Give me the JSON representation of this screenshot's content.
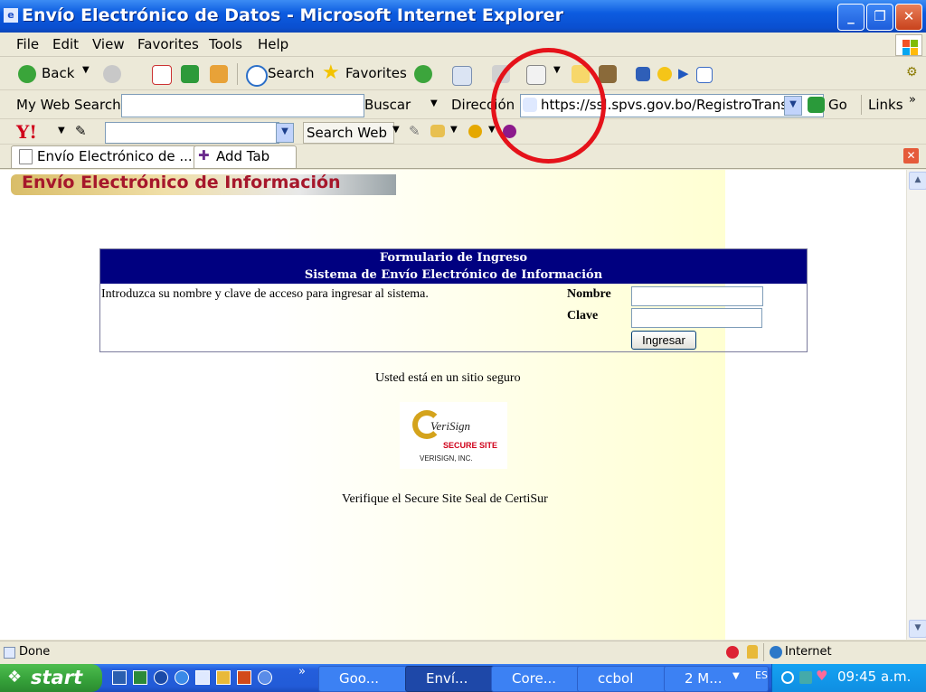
{
  "window": {
    "title": "Envío Electrónico de Datos - Microsoft Internet Explorer"
  },
  "menu": [
    "File",
    "Edit",
    "View",
    "Favorites",
    "Tools",
    "Help"
  ],
  "toolbar": {
    "back": "Back",
    "search": "Search",
    "favorites": "Favorites"
  },
  "searchbar": {
    "label": "My Web Search",
    "buscar": "Buscar",
    "address_label": "Dirección",
    "url": "https://ssl.spvs.gov.bo/RegistroTransf",
    "go": "Go",
    "links": "Links"
  },
  "yahoo": {
    "logo": "Y!",
    "search_web": "Search Web"
  },
  "tabs": {
    "active": "Envío Electrónico de ...",
    "add": "Add Tab"
  },
  "page": {
    "header": "Envío Electrónico de Información",
    "form": {
      "title1": "Formulario de Ingreso",
      "title2": "Sistema de Envío Electrónico de Información",
      "instructions": "Introduzca su nombre y clave de acceso para ingresar al sistema.",
      "name_label": "Nombre",
      "key_label": "Clave",
      "submit": "Ingresar"
    },
    "secure_text": "Usted está en un sitio seguro",
    "seal": {
      "brand": "VeriSign",
      "secure": "SECURE SITE",
      "company": "VERISIGN, INC."
    },
    "verify_text": "Verifique el Secure Site Seal de CertiSur"
  },
  "status": {
    "text": "Done",
    "zone": "Internet"
  },
  "taskbar": {
    "start": "start",
    "tasks": [
      "Goo...",
      "Enví...",
      "Core...",
      "ccbol",
      "2 M..."
    ],
    "lang": "ES",
    "clock": "09:45 a.m."
  },
  "colors": {
    "header_bg": "#000080",
    "title_text": "#a6172b",
    "annotation": "#e5121a"
  }
}
